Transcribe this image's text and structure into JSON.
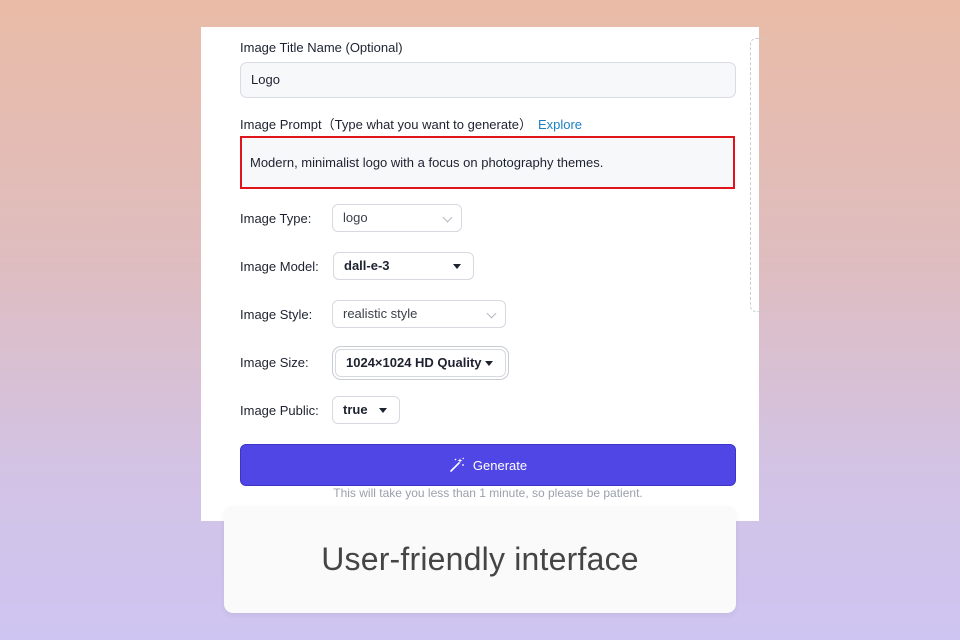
{
  "form": {
    "title_label": "Image Title Name (Optional)",
    "title_value": "Logo",
    "prompt_label": "Image Prompt",
    "prompt_hint": "（Type what you want to generate）",
    "explore_link": "Explore",
    "prompt_value": "Modern, minimalist logo with a focus on photography themes.",
    "type_label": "Image Type:",
    "type_value": "logo",
    "model_label": "Image Model:",
    "model_value": "dall-e-3",
    "style_label": "Image Style:",
    "style_value": "realistic style",
    "size_label": "Image Size:",
    "size_value": "1024×1024 HD Quality",
    "public_label": "Image Public:",
    "public_value": "true",
    "generate_label": "Generate",
    "note": "This will take you less than 1 minute, so please be patient."
  },
  "caption": "User-friendly interface",
  "colors": {
    "accent": "#4f46e5",
    "highlight": "#e0141b",
    "link": "#1a7fc4"
  },
  "icons": {
    "generate": "magic-wand-icon"
  }
}
